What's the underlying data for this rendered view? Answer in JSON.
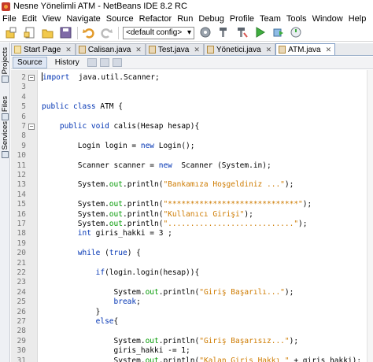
{
  "window": {
    "title": "Nesne Yönelimli ATM - NetBeans IDE 8.2 RC"
  },
  "menubar": [
    "File",
    "Edit",
    "View",
    "Navigate",
    "Source",
    "Refactor",
    "Run",
    "Debug",
    "Profile",
    "Team",
    "Tools",
    "Window",
    "Help"
  ],
  "toolbar": {
    "config_value": "<default config>",
    "icons": [
      "new-project-icon",
      "new-file-icon",
      "open-project-icon",
      "save-all-icon",
      "undo-icon",
      "redo-icon",
      "config-select",
      "build-icon",
      "clean-build-icon",
      "run-icon",
      "debug-icon",
      "profile-icon"
    ]
  },
  "sidebar": {
    "tabs": [
      "Projects",
      "Files",
      "Services"
    ]
  },
  "tabs": [
    {
      "label": "Start Page",
      "active": false
    },
    {
      "label": "Calisan.java",
      "active": false
    },
    {
      "label": "Test.java",
      "active": false
    },
    {
      "label": "Yönetici.java",
      "active": false
    },
    {
      "label": "ATM.java",
      "active": true
    }
  ],
  "subtabs": {
    "source": "Source",
    "history": "History"
  },
  "code_lines": [
    {
      "n": "2",
      "fold": "minus",
      "parts": [
        [
          "kw",
          "import"
        ],
        [
          "",
          "  java.util.Scanner;"
        ]
      ]
    },
    {
      "n": "3",
      "fold": "",
      "parts": []
    },
    {
      "n": "4",
      "fold": "",
      "parts": []
    },
    {
      "n": "5",
      "fold": "",
      "parts": [
        [
          "kw",
          "public class"
        ],
        [
          "",
          " ATM {"
        ]
      ]
    },
    {
      "n": "6",
      "fold": "",
      "parts": []
    },
    {
      "n": "7",
      "fold": "minus",
      "parts": [
        [
          "",
          "    "
        ],
        [
          "kw",
          "public void"
        ],
        [
          "",
          " calis(Hesap hesap){"
        ]
      ]
    },
    {
      "n": "8",
      "fold": "",
      "parts": []
    },
    {
      "n": "9",
      "fold": "",
      "parts": [
        [
          "",
          "        Login login = "
        ],
        [
          "kw",
          "new"
        ],
        [
          "",
          " Login();"
        ]
      ]
    },
    {
      "n": "10",
      "fold": "",
      "parts": []
    },
    {
      "n": "11",
      "fold": "",
      "parts": [
        [
          "",
          "        Scanner scanner = "
        ],
        [
          "kw",
          "new"
        ],
        [
          "",
          "  Scanner (System.in);"
        ]
      ]
    },
    {
      "n": "12",
      "fold": "",
      "parts": []
    },
    {
      "n": "13",
      "fold": "",
      "parts": [
        [
          "",
          "        System."
        ],
        [
          "fld",
          "out"
        ],
        [
          "",
          ".println("
        ],
        [
          "str",
          "\"Bankamıza Hoşgeldiniz ...\""
        ],
        [
          "",
          ");"
        ]
      ]
    },
    {
      "n": "14",
      "fold": "",
      "parts": []
    },
    {
      "n": "15",
      "fold": "",
      "parts": [
        [
          "",
          "        System."
        ],
        [
          "fld",
          "out"
        ],
        [
          "",
          ".println("
        ],
        [
          "str",
          "\"*****************************\""
        ],
        [
          "",
          ");"
        ]
      ]
    },
    {
      "n": "16",
      "fold": "",
      "parts": [
        [
          "",
          "        System."
        ],
        [
          "fld",
          "out"
        ],
        [
          "",
          ".println("
        ],
        [
          "str",
          "\"Kullanıcı Girişi\""
        ],
        [
          "",
          ");"
        ]
      ]
    },
    {
      "n": "17",
      "fold": "",
      "parts": [
        [
          "",
          "        System."
        ],
        [
          "fld",
          "out"
        ],
        [
          "",
          ".println("
        ],
        [
          "str",
          "\"............................\""
        ],
        [
          "",
          ");"
        ]
      ]
    },
    {
      "n": "18",
      "fold": "",
      "parts": [
        [
          "",
          "        "
        ],
        [
          "kw",
          "int"
        ],
        [
          "",
          " giris_hakki = 3 ;"
        ]
      ]
    },
    {
      "n": "19",
      "fold": "",
      "parts": []
    },
    {
      "n": "20",
      "fold": "",
      "parts": [
        [
          "",
          "        "
        ],
        [
          "kw",
          "while"
        ],
        [
          "",
          " ("
        ],
        [
          "kw",
          "true"
        ],
        [
          "",
          ") {"
        ]
      ]
    },
    {
      "n": "21",
      "fold": "",
      "parts": []
    },
    {
      "n": "22",
      "fold": "",
      "parts": [
        [
          "",
          "            "
        ],
        [
          "kw",
          "if"
        ],
        [
          "",
          "(login.login(hesap)){"
        ]
      ]
    },
    {
      "n": "23",
      "fold": "",
      "parts": []
    },
    {
      "n": "24",
      "fold": "",
      "parts": [
        [
          "",
          "                System."
        ],
        [
          "fld",
          "out"
        ],
        [
          "",
          ".println("
        ],
        [
          "str",
          "\"Giriş Başarılı...\""
        ],
        [
          "",
          ");"
        ]
      ]
    },
    {
      "n": "25",
      "fold": "",
      "parts": [
        [
          "",
          "                "
        ],
        [
          "kw",
          "break"
        ],
        [
          "",
          ";"
        ]
      ]
    },
    {
      "n": "26",
      "fold": "",
      "parts": [
        [
          "",
          "            }"
        ]
      ]
    },
    {
      "n": "27",
      "fold": "",
      "parts": [
        [
          "",
          "            "
        ],
        [
          "kw",
          "else"
        ],
        [
          "",
          "{"
        ]
      ]
    },
    {
      "n": "28",
      "fold": "",
      "parts": []
    },
    {
      "n": "29",
      "fold": "",
      "parts": [
        [
          "",
          "                System."
        ],
        [
          "fld",
          "out"
        ],
        [
          "",
          ".println("
        ],
        [
          "str",
          "\"Giriş Başarısız...\""
        ],
        [
          "",
          ");"
        ]
      ]
    },
    {
      "n": "30",
      "fold": "",
      "parts": [
        [
          "",
          "                giris_hakki -= 1;"
        ]
      ]
    },
    {
      "n": "31",
      "fold": "",
      "parts": [
        [
          "",
          "                System."
        ],
        [
          "fld",
          "out"
        ],
        [
          "",
          ".println("
        ],
        [
          "str",
          "\"Kalan Giriş Hakkı \""
        ],
        [
          "",
          " + giris_hakki);"
        ]
      ]
    },
    {
      "n": "32",
      "fold": "",
      "parts": []
    }
  ],
  "colors": {
    "keyword": "#0033b3",
    "string": "#ce7b00",
    "field": "#009900"
  }
}
